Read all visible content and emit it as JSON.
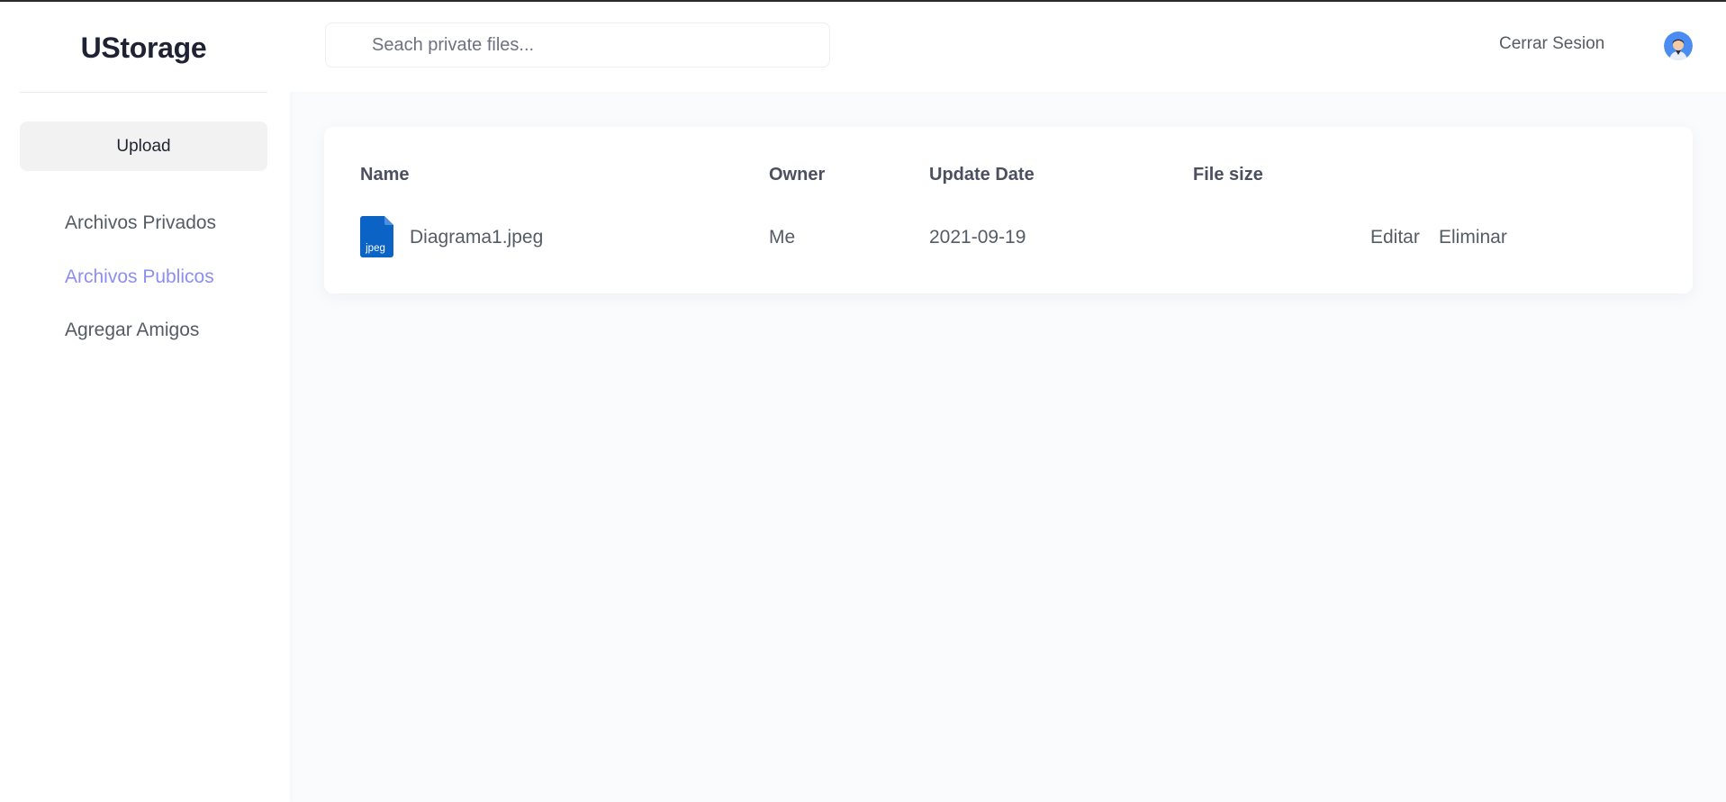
{
  "app": {
    "name": "UStorage"
  },
  "sidebar": {
    "upload_label": "Upload",
    "items": [
      {
        "label": "Archivos Privados",
        "active": false
      },
      {
        "label": "Archivos Publicos",
        "active": true
      },
      {
        "label": "Agregar Amigos",
        "active": false
      }
    ]
  },
  "topbar": {
    "search_placeholder": "Seach private files...",
    "search_value": "",
    "logout_label": "Cerrar Sesion",
    "avatar_icon": "user-avatar-icon"
  },
  "table": {
    "columns": {
      "name": "Name",
      "owner": "Owner",
      "update_date": "Update Date",
      "file_size": "File size"
    },
    "rows": [
      {
        "icon": "jpeg-file-icon",
        "icon_label": "jpeg",
        "name": "Diagrama1.jpeg",
        "owner": "Me",
        "update_date": "2021-09-19",
        "file_size": "",
        "actions": {
          "edit": "Editar",
          "delete": "Eliminar"
        }
      }
    ]
  },
  "colors": {
    "accent": "#8c8ff0",
    "file_icon": "#0b63c5",
    "background": "#fafbfd",
    "brand": "#1e2233"
  }
}
